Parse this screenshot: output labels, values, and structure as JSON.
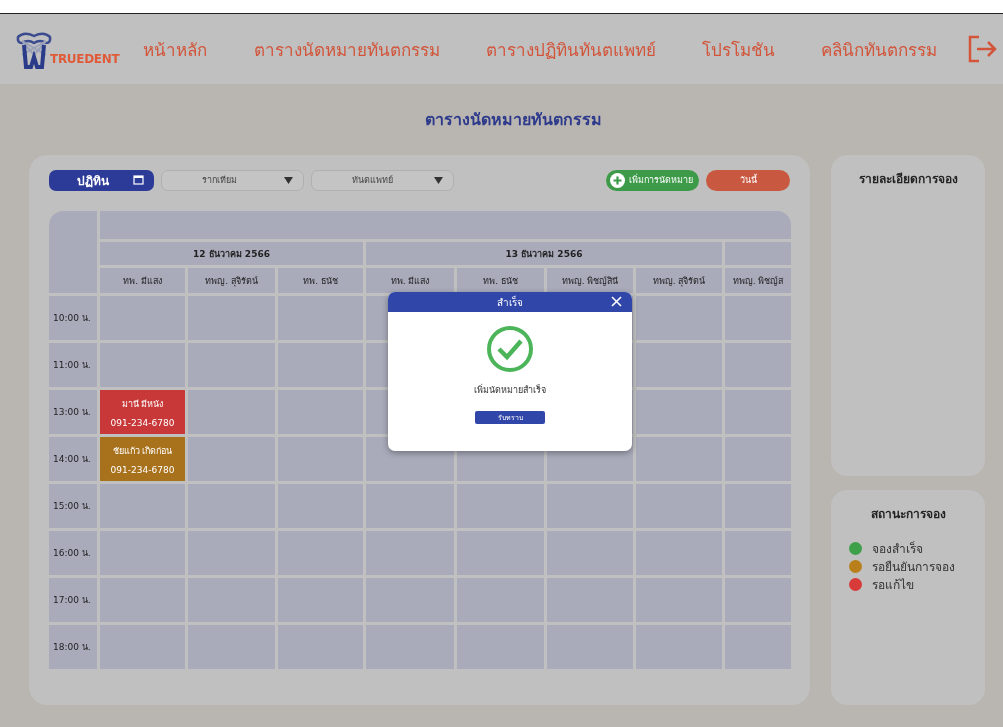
{
  "header": {
    "logo_text": "TRUEDENT",
    "nav": [
      "หน้าหลัก",
      "ตารางนัดหมายทันตกรรม",
      "ตารางปฏิทินทันตแพทย์",
      "โปรโมชัน",
      "คลินิกทันตกรรม"
    ]
  },
  "page_title": "ตารางนัดหมายทันตกรรม",
  "toolbar": {
    "calendar_button": "ปฏิทิน",
    "filters": [
      {
        "value": "รากเทียม"
      },
      {
        "value": "ทันตแพทย์"
      }
    ],
    "add_button": "เพิ่มการนัดหมาย",
    "today_button": "วันนี้"
  },
  "schedule": {
    "dates": [
      {
        "label": "12 ธันวาคม 2566",
        "doctors": [
          "ทพ. มีแสง",
          "ทพญ. สุจิรัตน์",
          "ทพ. ธนัช"
        ]
      },
      {
        "label": "13 ธันวาคม 2566",
        "doctors": [
          "ทพ. มีแสง",
          "ทพ. ธนัช",
          "ทพญ. พิชญ์สินี",
          "ทพญ. สุจิรัตน์"
        ]
      },
      {
        "doctors": [
          "ทพญ. พิชญ์ส"
        ]
      }
    ],
    "rows": [
      {
        "time": "10:00 น."
      },
      {
        "time": "11:00 น."
      },
      {
        "time": "13:00 น.",
        "slots": [
          {
            "name": "มานี มีหนัง",
            "phone": "091-234-6780",
            "color": "#c83838"
          }
        ]
      },
      {
        "time": "14:00 น.",
        "slots": [
          {
            "name": "ชัยแก้ว เกิดก่อน",
            "phone": "091-234-6780",
            "color": "#a8721c"
          }
        ]
      },
      {
        "time": "15:00 น."
      },
      {
        "time": "16:00 น."
      },
      {
        "time": "17:00 น."
      },
      {
        "time": "18:00 น."
      }
    ]
  },
  "dialog": {
    "title": "สำเร็จ",
    "message": "เพิ่มนัดหมายสำเร็จ",
    "button": "รับทราบ"
  },
  "booking_details": {
    "title": "รายละเอียดการจอง"
  },
  "status_legend": {
    "title": "สถานะการจอง",
    "items": [
      {
        "label": "จองสำเร็จ",
        "color": "#3fa04a"
      },
      {
        "label": "รอยืนยันการจอง",
        "color": "#b97f1a"
      },
      {
        "label": "รอแก้ไข",
        "color": "#d83a3a"
      }
    ]
  }
}
